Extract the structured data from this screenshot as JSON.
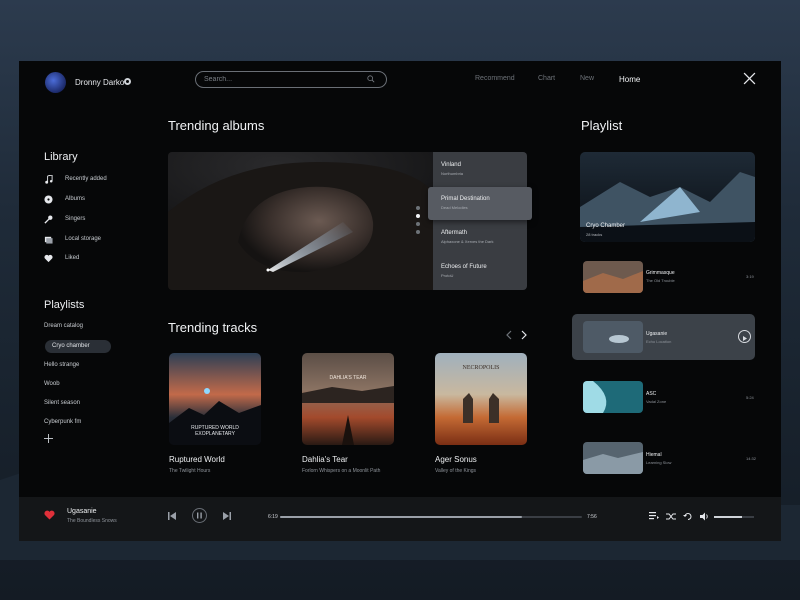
{
  "user": {
    "name": "Dronny Darko"
  },
  "search": {
    "placeholder": "Search..."
  },
  "nav": {
    "items": [
      "Recommend",
      "Chart",
      "New",
      "Home"
    ],
    "active": "Home"
  },
  "library": {
    "title": "Library",
    "items": [
      {
        "label": "Recently added",
        "icon": "music-note-icon"
      },
      {
        "label": "Albums",
        "icon": "album-icon"
      },
      {
        "label": "Singers",
        "icon": "microphone-icon"
      },
      {
        "label": "Local storage",
        "icon": "folder-icon"
      },
      {
        "label": "Liked",
        "icon": "heart-icon"
      }
    ]
  },
  "playlists": {
    "title": "Playlists",
    "items": [
      "Dream catalog",
      "Cryo chamber",
      "Hello strange",
      "Woob",
      "Silent season",
      "Cyberpunk fm"
    ],
    "active": "Cryo chamber"
  },
  "trending_albums": {
    "title": "Trending albums",
    "items": [
      {
        "title": "Vinland",
        "artist": "Northumbria"
      },
      {
        "title": "Primal Destination",
        "artist": "Dead Melodies"
      },
      {
        "title": "Aftermath",
        "artist": "Alphaxone & Xerxes the Dark"
      },
      {
        "title": "Echoes of Future",
        "artist": "ProtoU"
      }
    ],
    "active_index": 1,
    "slides": 4,
    "active_slide": 1
  },
  "trending_tracks": {
    "title": "Trending tracks",
    "items": [
      {
        "title": "Ruptured World",
        "artist": "The Twilight Hours",
        "cover_text": "RUPTURED WORLD",
        "cover_sub": "EXOPLANETARY"
      },
      {
        "title": "Dahlia's Tear",
        "artist": "Forlorn Whispers on a Moonlit Path",
        "cover_text": "DAHLIA'S TEAR"
      },
      {
        "title": "Ager Sonus",
        "artist": "Valley of the Kings",
        "cover_text": "NECROPOLIS"
      }
    ]
  },
  "playlist_panel": {
    "title": "Playlist",
    "featured": {
      "title": "Cryo Chamber",
      "count": "28 tracks"
    },
    "tracks": [
      {
        "title": "Grimmasque",
        "artist": "The Old Trouble",
        "duration": "3:19"
      },
      {
        "title": "Ugasanie",
        "artist": "Echo Location",
        "duration": ""
      },
      {
        "title": "ASC",
        "artist": "Vadal Zone",
        "duration": "5:24"
      },
      {
        "title": "Hiemal",
        "artist": "Learning Slow",
        "duration": "14:32"
      }
    ],
    "active_index": 1
  },
  "player": {
    "title": "Ugasanie",
    "artist": "The Boundless Snows",
    "elapsed": "6:19",
    "total": "7:56",
    "progress": 0.8,
    "volume": 0.7,
    "liked": true
  },
  "colors": {
    "accent_heart": "#e0303a",
    "background": "#060708",
    "panel": "#3a3d42"
  }
}
